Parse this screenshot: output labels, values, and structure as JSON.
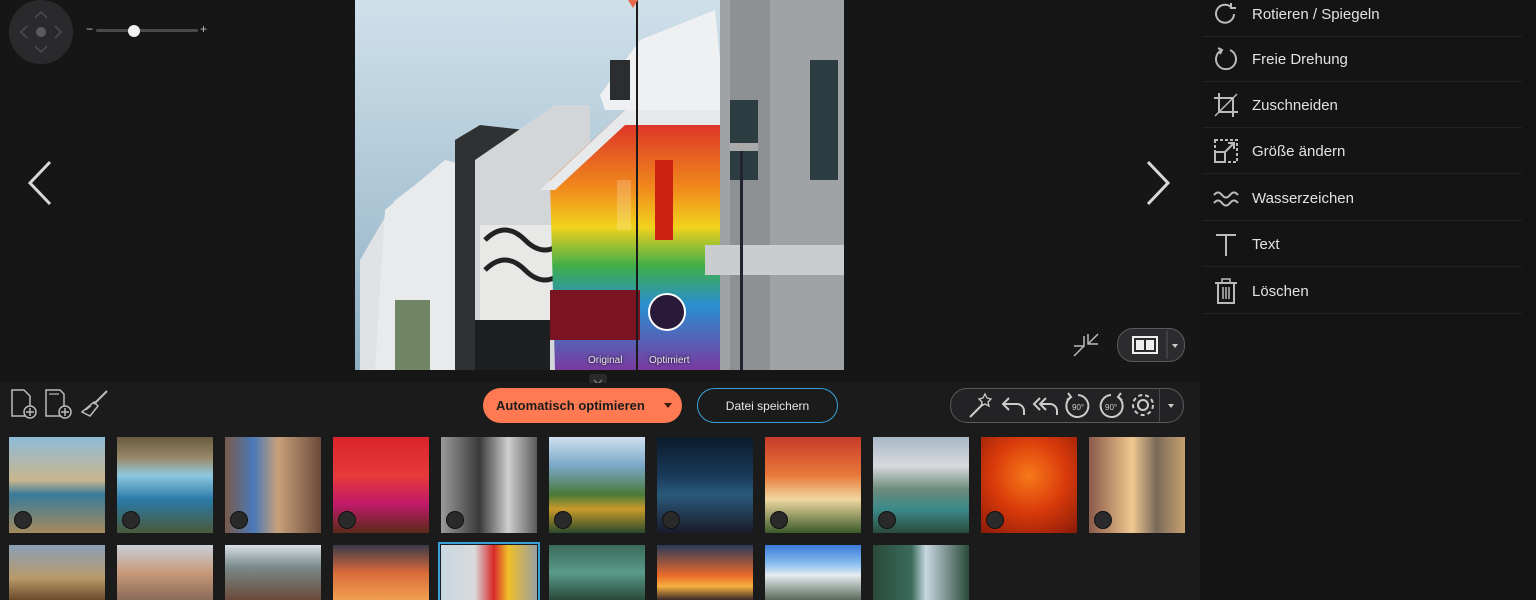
{
  "viewer": {
    "zoom_minus": "−",
    "zoom_plus": "+",
    "zoom_level": 0.37,
    "compare_label_left": "Original",
    "compare_label_right": "Optimiert"
  },
  "menu": [
    {
      "label": "Rotieren / Spiegeln",
      "icon": "rotate-flip-icon"
    },
    {
      "label": "Freie Drehung",
      "icon": "free-rotate-icon"
    },
    {
      "label": "Zuschneiden",
      "icon": "crop-icon"
    },
    {
      "label": "Größe ändern",
      "icon": "resize-icon"
    },
    {
      "label": "Wasserzeichen",
      "icon": "watermark-icon"
    },
    {
      "label": "Text",
      "icon": "text-icon"
    },
    {
      "label": "Löschen",
      "icon": "trash-icon"
    }
  ],
  "toolbar": {
    "auto_optimize_label": "Automatisch optimieren",
    "save_label": "Datei speichern"
  },
  "colors": {
    "accent_orange": "#ff7a52",
    "accent_blue": "#3aa0d8",
    "background": "#161617"
  },
  "thumbnails_row1": [
    "coast-cliffs",
    "waterfall",
    "cathedral",
    "red-lanterns",
    "bw-tower",
    "pagoda",
    "night-city",
    "autumn-house",
    "mountain-lake",
    "red-leaves",
    "old-street"
  ],
  "thumbnails_row2": [
    "hill-town",
    "city-roofs",
    "rooftops",
    "sunset-palm",
    "rainbow-street",
    "reef",
    "orange-sunset",
    "mountain-sky",
    "forest-waterfall"
  ]
}
